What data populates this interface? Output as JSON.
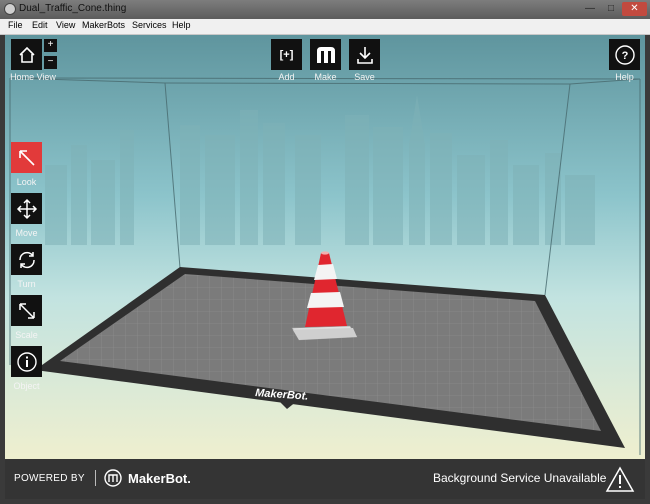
{
  "window": {
    "title": "Dual_Traffic_Cone.thing",
    "minimize": "—",
    "maximize": "□",
    "close": "✕"
  },
  "menu": [
    "File",
    "Edit",
    "View",
    "MakerBots",
    "Services",
    "Help"
  ],
  "top_toolbar": {
    "home_label": "Home View",
    "zoom_in": "+",
    "zoom_out": "−",
    "add_label": "Add",
    "add_glyph": "[+]",
    "make_label": "Make",
    "save_label": "Save",
    "help_label": "Help",
    "help_glyph": "?"
  },
  "side_tools": [
    {
      "name": "look",
      "label": "Look",
      "icon": "look-arrow-icon",
      "active": true
    },
    {
      "name": "move",
      "label": "Move",
      "icon": "move-arrows-icon",
      "active": false
    },
    {
      "name": "turn",
      "label": "Turn",
      "icon": "rotate-icon",
      "active": false
    },
    {
      "name": "scale",
      "label": "Scale",
      "icon": "scale-icon",
      "active": false
    },
    {
      "name": "object",
      "label": "Object",
      "icon": "info-icon",
      "active": false
    }
  ],
  "platform": {
    "logo_text": "MakerBot."
  },
  "footer": {
    "powered_by": "POWERED BY",
    "brand": "MakerBot.",
    "status": "Background Service Unavailable",
    "warning_icon": "warning-icon"
  },
  "colors": {
    "active_tool": "#e23a3a",
    "cone_red": "#e0262f",
    "button_bg": "#111111",
    "footer_bg": "#343434"
  }
}
